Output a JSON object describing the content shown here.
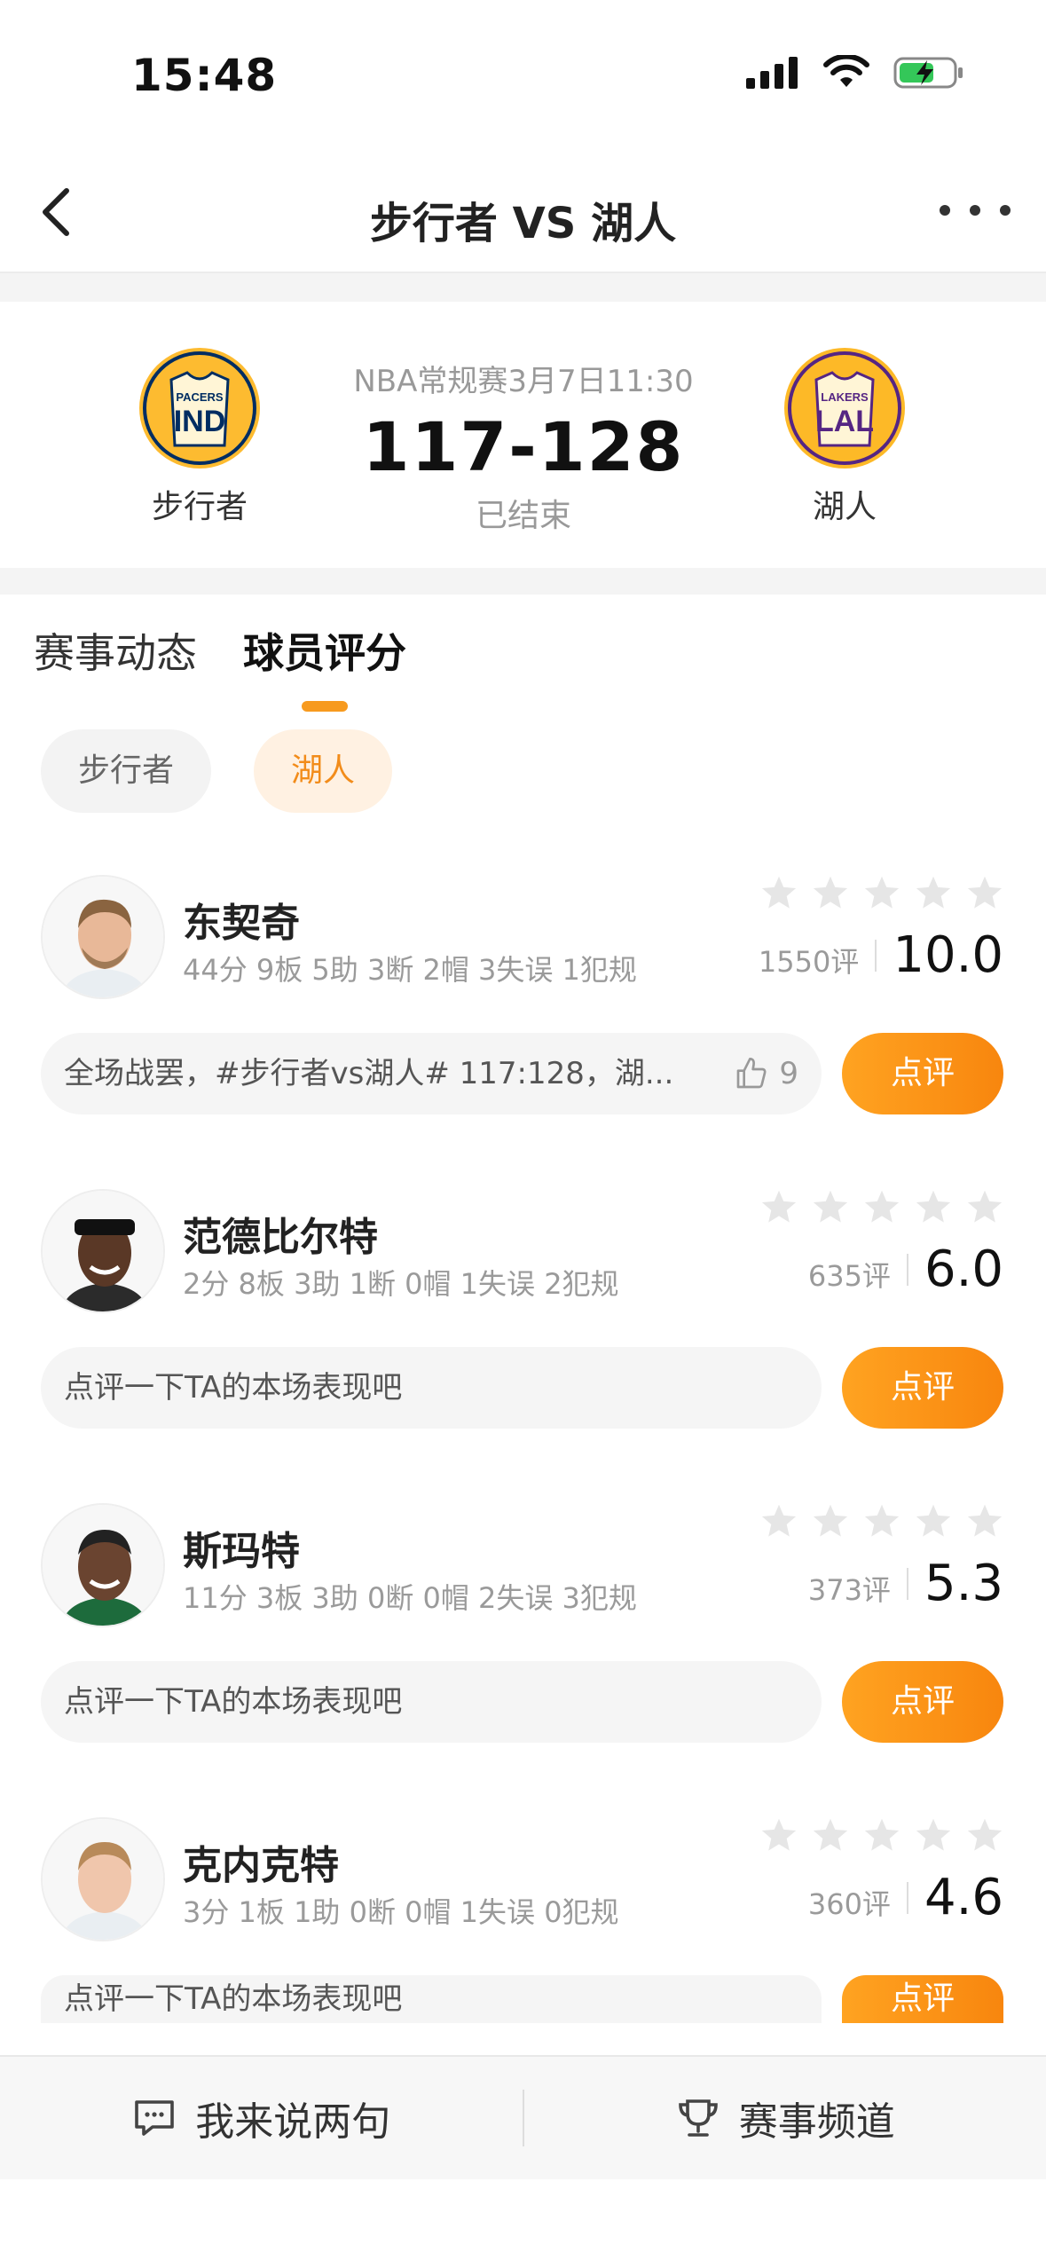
{
  "status_bar": {
    "time": "15:48"
  },
  "nav": {
    "title": "步行者 VS 湖人"
  },
  "match": {
    "meta": "NBA常规赛3月7日11:30",
    "score": "117-128",
    "status": "已结束",
    "home": {
      "name": "步行者",
      "logo_text_top": "PACERS",
      "logo_text": "IND",
      "color": "#fdbb30",
      "accent": "#002d62"
    },
    "away": {
      "name": "湖人",
      "logo_text_top": "LAKERS",
      "logo_text": "LAL",
      "color": "#fdb927",
      "accent": "#552583"
    }
  },
  "tabs": [
    {
      "label": "赛事动态",
      "active": false
    },
    {
      "label": "球员评分",
      "active": true
    }
  ],
  "team_filters": [
    {
      "label": "步行者",
      "active": false
    },
    {
      "label": "湖人",
      "active": true
    }
  ],
  "players": [
    {
      "name": "东契奇",
      "stats": "44分 9板 5助 3断 2帽 3失误 1犯规",
      "rating_count": "1550评",
      "score": "10.0",
      "comment": "全场战罢，#步行者vs湖人# 117:128，湖...",
      "likes": "9",
      "review_label": "点评"
    },
    {
      "name": "范德比尔特",
      "stats": "2分 8板 3助 1断 0帽 1失误 2犯规",
      "rating_count": "635评",
      "score": "6.0",
      "comment": "点评一下TA的本场表现吧",
      "likes": null,
      "review_label": "点评"
    },
    {
      "name": "斯玛特",
      "stats": "11分 3板 3助 0断 0帽 2失误 3犯规",
      "rating_count": "373评",
      "score": "5.3",
      "comment": "点评一下TA的本场表现吧",
      "likes": null,
      "review_label": "点评"
    },
    {
      "name": "克内克特",
      "stats": "3分 1板 1助 0断 0帽 1失误 0犯规",
      "rating_count": "360评",
      "score": "4.6",
      "comment": "点评一下TA的本场表现吧",
      "likes": null,
      "review_label": "点评"
    }
  ],
  "bottom_bar": {
    "comment_label": "我来说两句",
    "channel_label": "赛事频道"
  },
  "colors": {
    "accent": "#f8860e",
    "star": "#e6e6e6"
  }
}
